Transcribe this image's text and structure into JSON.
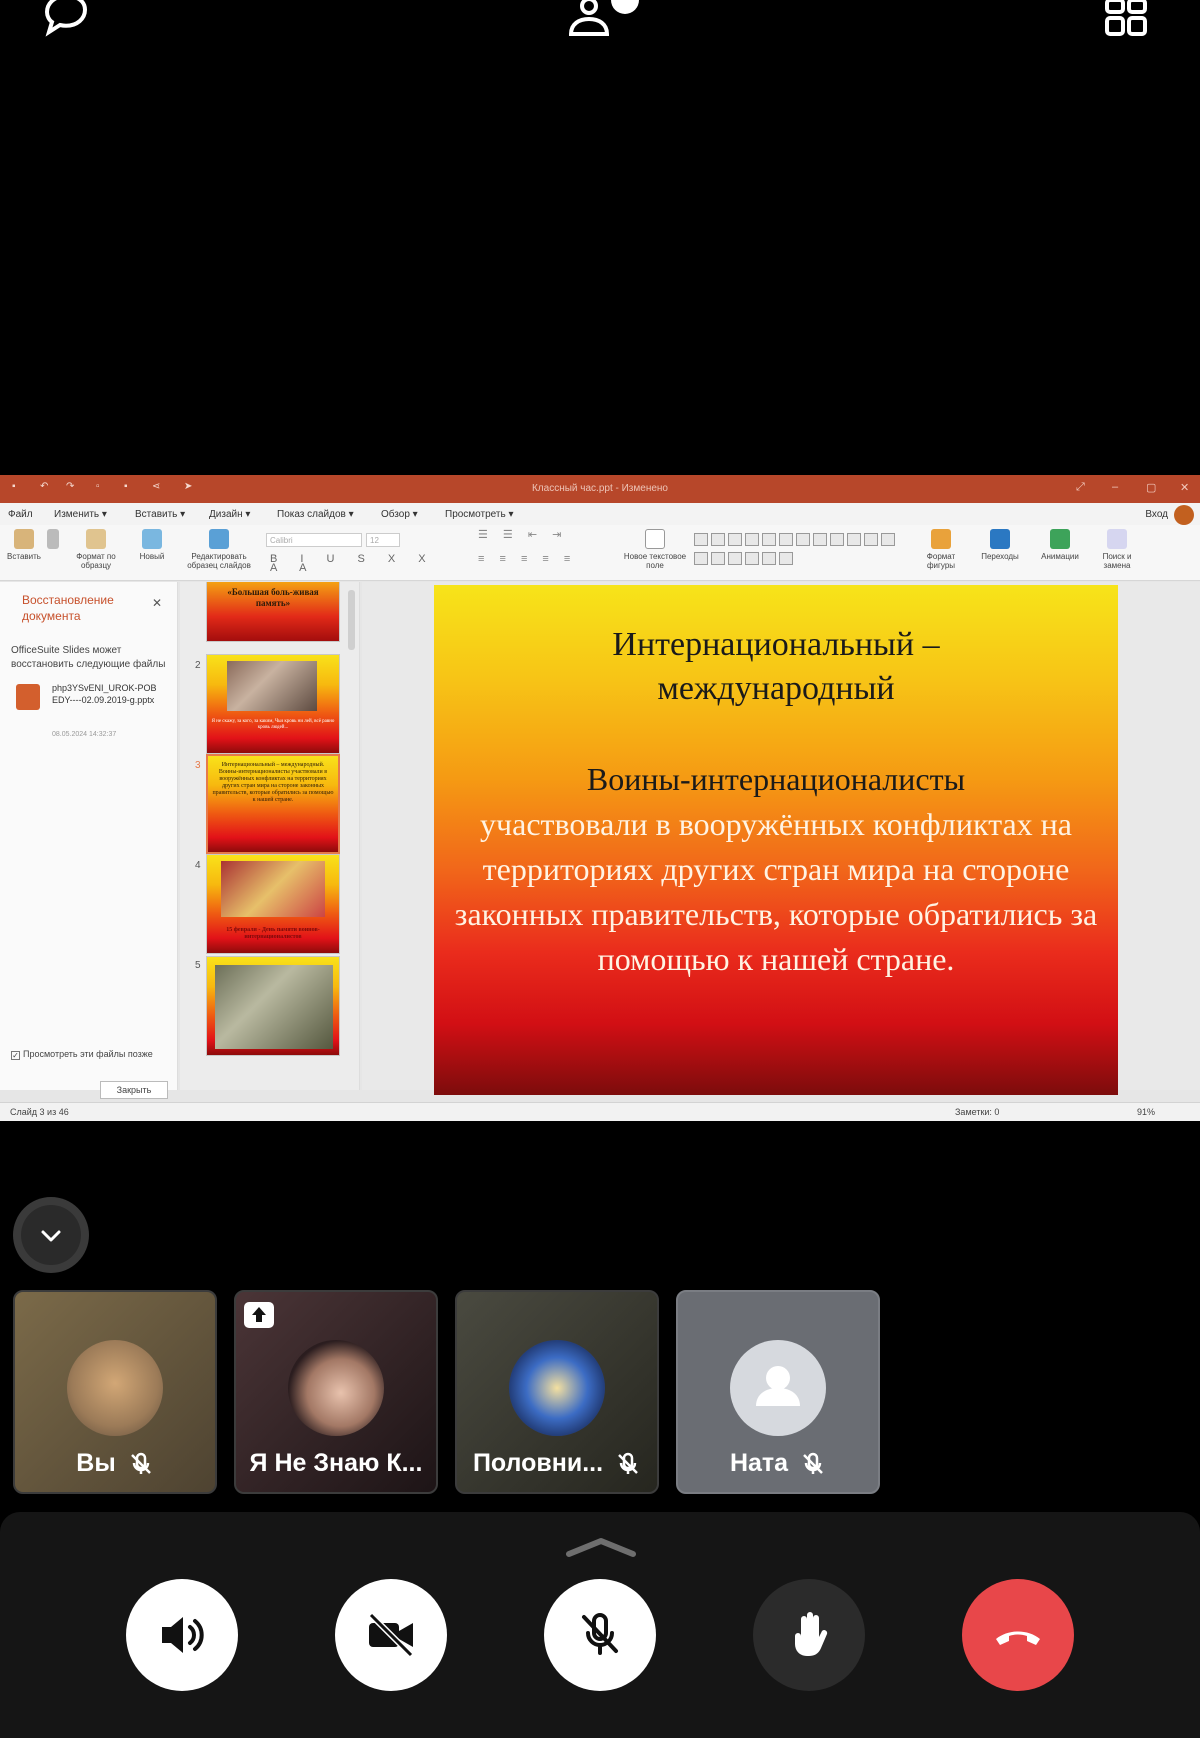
{
  "app": {
    "window_title": "Классный час.ppt - Изменено"
  },
  "menu": {
    "items": [
      "Файл",
      "Изменить ▾",
      "Вставить ▾",
      "Дизайн ▾",
      "Показ слайдов ▾",
      "Обзор ▾",
      "Просмотреть ▾"
    ],
    "login": "Вход"
  },
  "ribbon": {
    "paste": "Вставить",
    "format_painter": "Формат по образцу",
    "new_slide": "Новый",
    "edit_master": "Редактировать образец слайдов",
    "font_name": "Calibri",
    "font_size": "12",
    "new_textbox": "Новое текстовое поле",
    "shape_format": "Формат фигуры",
    "transitions": "Переходы",
    "animations": "Анимации",
    "find_replace": "Поиск и замена"
  },
  "recovery": {
    "title": "Восстановление документа",
    "description": "OfficeSuite Slides может восстановить следующие файлы",
    "file_name": "php3YSvENI_UROK-POBEDY----02.09.2019-g.pptx",
    "file_date": "08.05.2024 14:32:37",
    "checkbox_label": "Просмотреть эти файлы позже",
    "close_button": "Закрыть"
  },
  "thumbnails": [
    {
      "num": "",
      "text": "«Большая боль-живая память»"
    },
    {
      "num": "2",
      "text": "Я не скажу, за кого, за каким, Чьи кровь ни лей, всё равно кровь людей..."
    },
    {
      "num": "3",
      "text": "Интернациональный – международный. Воины-интернационалисты участвовали в вооружённых конфликтах на территориях других стран мира на стороне законных правительств, которые обратились за помощью к нашей стране."
    },
    {
      "num": "4",
      "text": "15 февраля - День памяти воинов-интернационалистов"
    },
    {
      "num": "5",
      "text": ""
    }
  ],
  "slide": {
    "title": "Интернациональный – международный",
    "body_line1": "Воины-интернационалисты",
    "body_rest": "участвовали в вооружённых конфликтах на территориях других стран мира на стороне законных правительств, которые обратились за помощью к нашей стране."
  },
  "status": {
    "slide_counter": "Слайд 3 из 46",
    "notes": "Заметки: 0",
    "zoom": "91%"
  },
  "participants": [
    {
      "name": "Вы",
      "muted": true,
      "color": "#6b5a3e"
    },
    {
      "name": "Я Не Знаю К...",
      "muted": false,
      "color": "#3a2a2c"
    },
    {
      "name": "Половни...",
      "muted": true,
      "color": "#3b3a33"
    },
    {
      "name": "Ната",
      "muted": true,
      "color": "#6b6e74"
    }
  ],
  "colors": {
    "end_call": "#e8474a",
    "accent_orange": "#b7472a"
  }
}
